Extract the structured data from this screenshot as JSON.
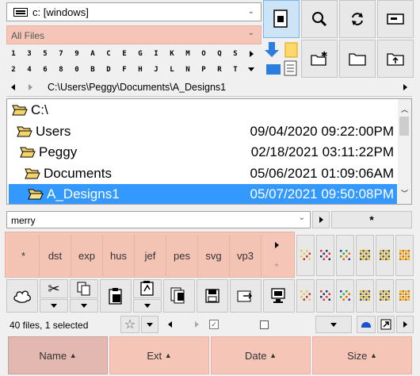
{
  "drive": {
    "value": "c: [windows]"
  },
  "filter": {
    "value": "All Files"
  },
  "keys_row1": [
    "1",
    "3",
    "5",
    "7",
    "9",
    "A",
    "C",
    "E",
    "G",
    "I",
    "K",
    "M",
    "O",
    "Q",
    "S"
  ],
  "keys_row2": [
    "2",
    "4",
    "6",
    "8",
    "0",
    "B",
    "D",
    "F",
    "H",
    "J",
    "L",
    "N",
    "P",
    "R",
    "T"
  ],
  "path": {
    "value": "C:\\Users\\Peggy\\Documents\\A_Designs1"
  },
  "tree": [
    {
      "name": "C:\\",
      "date": ""
    },
    {
      "name": "Users",
      "date": "09/04/2020 09:22:00PM"
    },
    {
      "name": "Peggy",
      "date": "02/18/2021 03:11:22PM"
    },
    {
      "name": "Documents",
      "date": "05/06/2021 01:09:06AM"
    },
    {
      "name": "A_Designs1",
      "date": "05/07/2021 09:50:08PM"
    }
  ],
  "search": {
    "value": "merry",
    "star_label": "*"
  },
  "ext_filters": [
    "*",
    "dst",
    "exp",
    "hus",
    "jef",
    "pes",
    "svg",
    "vp3"
  ],
  "ext_star": "*",
  "status": {
    "text": "40 files, 1 selected"
  },
  "columns": [
    {
      "label": "Name",
      "sort": "▲"
    },
    {
      "label": "Ext",
      "sort": "▲"
    },
    {
      "label": "Date",
      "sort": "▲"
    },
    {
      "label": "Size",
      "sort": "▲"
    }
  ],
  "colors": {
    "selection": "#3399ff",
    "highlight": "#f5c6b8",
    "selected_button": "#cde4f7"
  }
}
